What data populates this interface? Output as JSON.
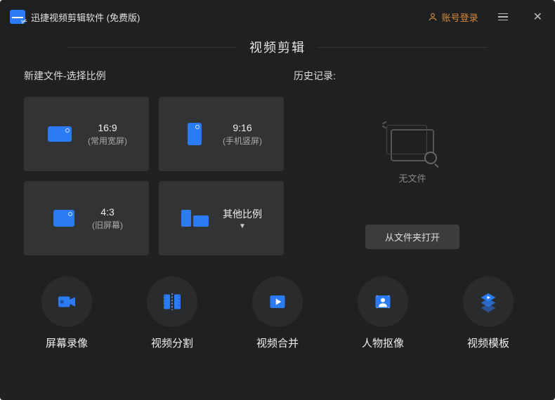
{
  "titlebar": {
    "app_name": "迅捷视频剪辑软件 (免费版)",
    "login_label": "账号登录"
  },
  "section": {
    "title": "视频剪辑"
  },
  "newfile": {
    "label": "新建文件-选择比例",
    "ratios": [
      {
        "title": "16:9",
        "sub": "(常用宽屏)"
      },
      {
        "title": "9:16",
        "sub": "(手机竖屏)"
      },
      {
        "title": "4:3",
        "sub": "(旧屏幕)"
      },
      {
        "title": "其他比例",
        "sub": ""
      }
    ]
  },
  "history": {
    "label": "历史记录:",
    "empty_text": "无文件",
    "open_folder_label": "从文件夹打开"
  },
  "tools": [
    {
      "label": "屏幕录像"
    },
    {
      "label": "视频分割"
    },
    {
      "label": "视频合并"
    },
    {
      "label": "人物抠像"
    },
    {
      "label": "视频模板"
    }
  ],
  "colors": {
    "accent": "#2b7bf5"
  }
}
